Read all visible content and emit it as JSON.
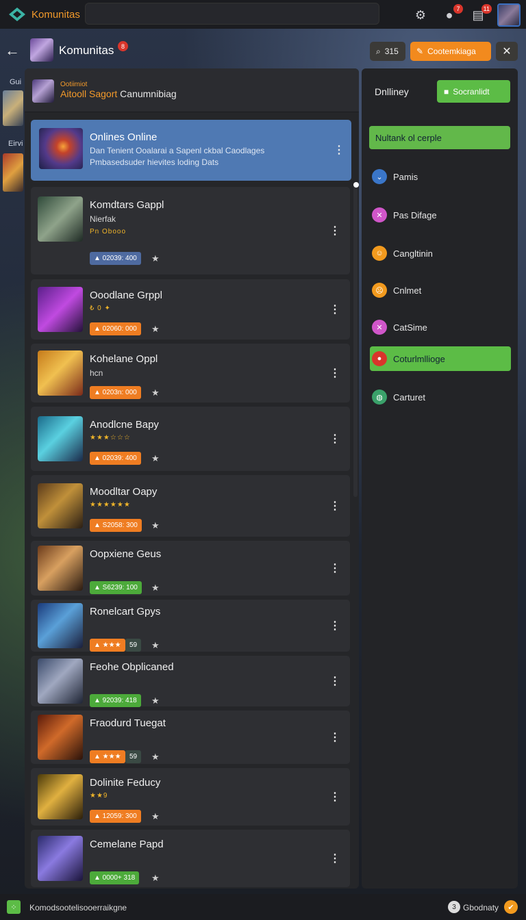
{
  "topbar": {
    "app_title": "Komunitas",
    "notif_badge_1": "7",
    "notif_badge_2": "11",
    "icons": [
      "gear-icon",
      "chat-bubble-icon",
      "message-icon"
    ]
  },
  "header": {
    "title": "Komunitas",
    "title_badge": "8",
    "count_label": "315",
    "create_label": "Cootemkiaga",
    "close_label": "✕"
  },
  "edge": {
    "label_1": "Gui",
    "label_2": "Eirvi"
  },
  "subheader": {
    "small_text": "Ootiimiot",
    "big_text_highlight": "Aitooll Sagort",
    "big_text_rest": " Canumnibiag"
  },
  "feature": {
    "title": "Onlines Online",
    "line1": "Dan Tenient Ooalarai a Sapenl ckbal Caodlages",
    "line2": "Pmbasedsuder hievites loding Dats"
  },
  "games": [
    {
      "title": "Komdtars Gappl",
      "sub": "Nierfak",
      "meta": "Pn Obooo",
      "stat": "02039: 400",
      "pill": "blue"
    },
    {
      "title": "Ooodlane Grppl",
      "sub": "",
      "meta": "₺ 0 ✦",
      "stat": "02060: 000",
      "pill": "orange"
    },
    {
      "title": "Kohelane Oppl",
      "sub": "hcn",
      "meta": "",
      "stat": "0203n: 000",
      "pill": "orange"
    },
    {
      "title": "Anodlcne Bapy",
      "sub": "",
      "meta": "★★★☆☆☆",
      "stat": "02039: 400",
      "pill": "orange"
    },
    {
      "title": "Moodltar Oapy",
      "sub": "",
      "meta": "★★★★★★",
      "stat": "S2058: 300",
      "pill": "orange"
    },
    {
      "title": "Oopxiene Geus",
      "sub": "",
      "meta": "",
      "stat": "S6239: 100",
      "pill": "green"
    },
    {
      "title": "Ronelcart Gpys",
      "sub": "",
      "meta": "",
      "stat": "★★★",
      "pill": "orange",
      "extra": "59"
    },
    {
      "title": "Feohe Obplicaned",
      "sub": "",
      "meta": "",
      "stat": "92039: 418",
      "pill": "green"
    },
    {
      "title": "Fraodurd Tuegat",
      "sub": "",
      "meta": "",
      "stat": "★★★",
      "pill": "orange",
      "extra": "59"
    },
    {
      "title": "Dolinite Feducy",
      "sub": "",
      "meta": "★★9",
      "stat": "12059: 300",
      "pill": "orange"
    },
    {
      "title": "Cemelane Papd",
      "sub": "",
      "meta": "",
      "stat": "0000+ 318",
      "pill": "green"
    }
  ],
  "right": {
    "title": "Dnlliney",
    "button": "Socranlidt",
    "banner": "Nultank ol cerple",
    "items": [
      {
        "label": "Pamis",
        "icon": "chevron-down-icon",
        "color": "#3a76c9",
        "glyph": "⌄"
      },
      {
        "label": "Pas Difage",
        "icon": "cross-icon",
        "color": "#d056c9",
        "glyph": "✕"
      },
      {
        "label": "Cangltinin",
        "icon": "face-icon",
        "color": "#f29a1e",
        "glyph": "☺"
      },
      {
        "label": "Cnlmet",
        "icon": "sad-face-icon",
        "color": "#f29a1e",
        "glyph": "☹"
      },
      {
        "label": "CatSime",
        "icon": "cross-icon",
        "color": "#d056c9",
        "glyph": "✕"
      },
      {
        "label": "Coturlmllioge",
        "icon": "record-icon",
        "color": "#d9352b",
        "glyph": "●"
      },
      {
        "label": "Carturet",
        "icon": "globe-icon",
        "color": "#3aa16a",
        "glyph": "◍"
      }
    ]
  },
  "bottom": {
    "text": "Komodsootelisooerraikgne",
    "right_text": "Gbodnaty",
    "right_icon": "3",
    "badge": "✔"
  }
}
